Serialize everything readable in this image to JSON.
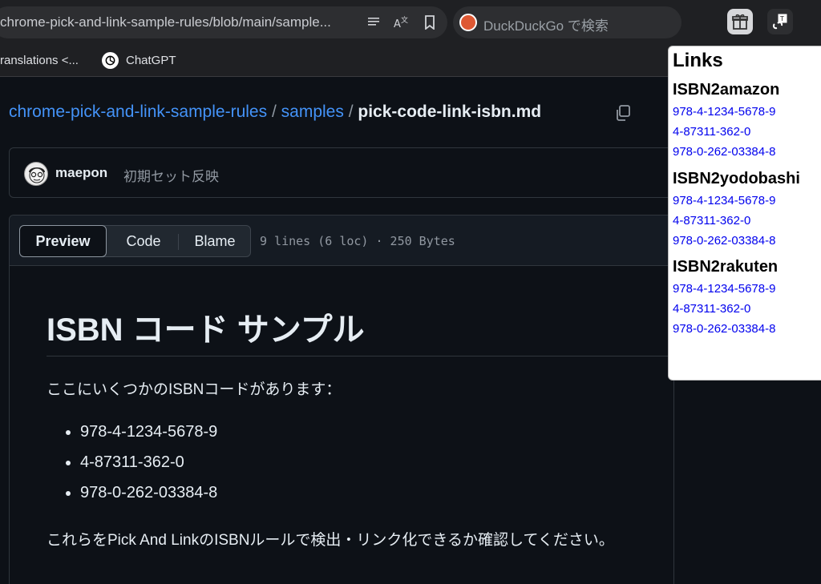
{
  "browser": {
    "url": "chrome-pick-and-link-sample-rules/blob/main/sample...",
    "search_placeholder": "DuckDuckGo で検索",
    "bookmarks": [
      {
        "label": "ranslations <..."
      },
      {
        "label": "ChatGPT"
      }
    ]
  },
  "repo": {
    "breadcrumb": {
      "repo": "chrome-pick-and-link-sample-rules",
      "sep": "/",
      "folder": "samples",
      "file": "pick-code-link-isbn.md"
    },
    "commit": {
      "author": "maepon",
      "message": "初期セット反映"
    },
    "file_header": {
      "tabs": [
        "Preview",
        "Code",
        "Blame"
      ],
      "meta": "9 lines (6 loc) · 250 Bytes"
    }
  },
  "markdown": {
    "title": "ISBN コード サンプル",
    "intro": "ここにいくつかのISBNコードがあります：",
    "items": [
      "978-4-1234-5678-9",
      "4-87311-362-0",
      "978-0-262-03384-8"
    ],
    "outro": "これらをPick And LinkのISBNルールで検出・リンク化できるか確認してください。"
  },
  "popup": {
    "title": "Links",
    "groups": [
      {
        "title": "ISBN2amazon",
        "links": [
          "978-4-1234-5678-9",
          "4-87311-362-0",
          "978-0-262-03384-8"
        ]
      },
      {
        "title": "ISBN2yodobashi",
        "links": [
          "978-4-1234-5678-9",
          "4-87311-362-0",
          "978-0-262-03384-8"
        ]
      },
      {
        "title": "ISBN2rakuten",
        "links": [
          "978-4-1234-5678-9",
          "4-87311-362-0",
          "978-0-262-03384-8"
        ]
      }
    ]
  },
  "colors": {
    "link_blue": "#4493f8",
    "popup_link": "#0000ee",
    "page_bg": "#0d1117"
  }
}
